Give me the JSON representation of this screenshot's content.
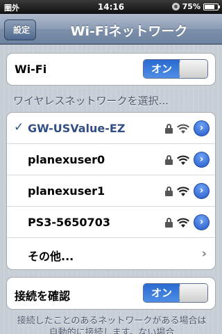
{
  "status": {
    "carrier": "圏外",
    "time": "14:16",
    "battery_percent": "75%",
    "battery_level": 0.75
  },
  "nav": {
    "back_label": "設定",
    "title": "Wi-Fiネットワーク"
  },
  "wifi_section": {
    "label": "Wi-Fi",
    "toggle": "オン",
    "enabled": true
  },
  "networks_section": {
    "header": "ワイヤレスネットワークを選択...",
    "networks": [
      {
        "name": "GW-USValue-EZ",
        "selected": true,
        "secured": true
      },
      {
        "name": "planexuser0",
        "selected": false,
        "secured": true
      },
      {
        "name": "planexuser1",
        "selected": false,
        "secured": true
      },
      {
        "name": "PS3-5650703",
        "selected": false,
        "secured": true
      }
    ],
    "other_label": "その他...",
    "checkmark": "✓"
  },
  "ask_section": {
    "label": "接続を確認",
    "toggle": "オン",
    "enabled": true
  },
  "footer": {
    "text": "接続したことのあるネットワークがある場合は自動的に接続します。ない場合"
  },
  "colors": {
    "accent": "#324f85",
    "toggle_on": "#2a6ad0",
    "navbar": "#6d83a1"
  }
}
